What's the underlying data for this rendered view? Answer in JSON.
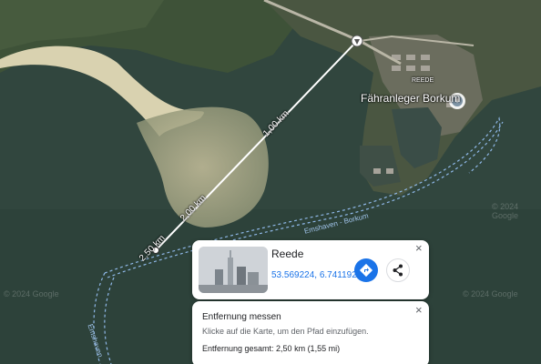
{
  "map": {
    "place_label": "Fähranleger Borkum",
    "area_label": "REEDE",
    "distance_labels": [
      "1,00 km",
      "2,00 km",
      "2,50 km"
    ],
    "route_label": "Emshaven - Borkum",
    "route_label_2": "Emshaven",
    "watermarks": [
      "© 2024 Google",
      "© 2024 Google",
      "© 2024 Google"
    ],
    "colors": {
      "water": "#31463e",
      "sand": "#c9c3a0",
      "measure_line": "#ffffff",
      "route": "#8fb8e8"
    }
  },
  "place_card": {
    "title": "Reede",
    "coordinates": "53.569224, 6.741192",
    "close_icon": "×",
    "directions_icon": "directions-icon",
    "share_icon": "share-icon"
  },
  "measure_card": {
    "title": "Entfernung messen",
    "hint": "Klicke auf die Karte, um den Pfad einzufügen.",
    "total": "Entfernung gesamt: 2,50 km (1,55 mi)",
    "close_icon": "×"
  }
}
